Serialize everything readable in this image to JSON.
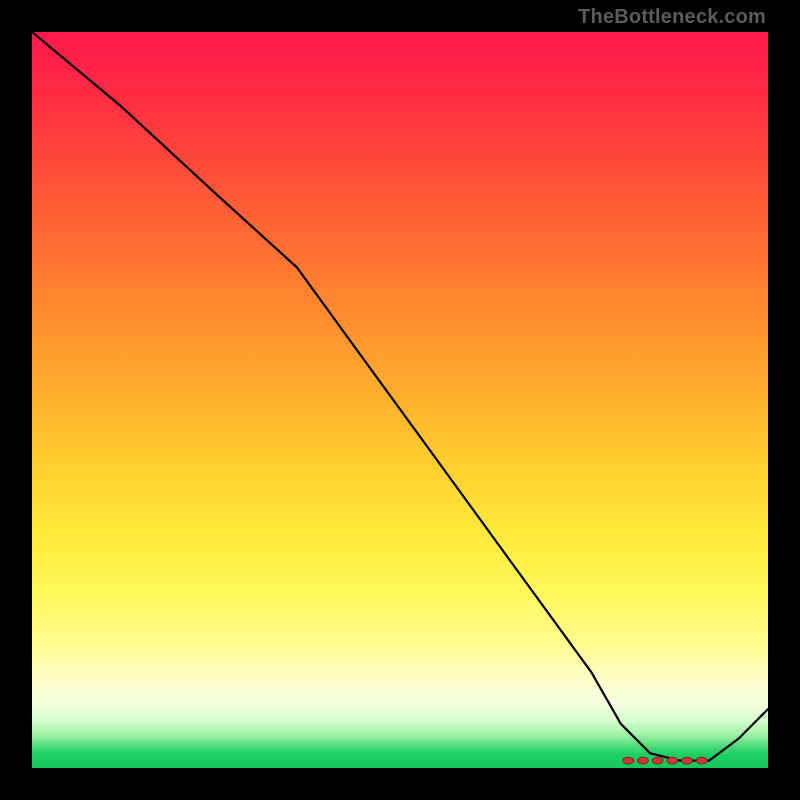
{
  "watermark": "TheBottleneck.com",
  "chart_data": {
    "type": "line",
    "title": "",
    "xlabel": "",
    "ylabel": "",
    "xlim": [
      0,
      100
    ],
    "ylim": [
      0,
      100
    ],
    "grid": false,
    "series": [
      {
        "name": "curve",
        "x": [
          0,
          12,
          25,
          36,
          44,
          52,
          60,
          68,
          76,
          80,
          84,
          88,
          92,
          96,
          100
        ],
        "values": [
          100,
          90,
          78,
          68,
          57,
          46,
          35,
          24,
          13,
          6,
          2,
          1,
          1,
          4,
          8
        ]
      }
    ],
    "markers": {
      "name": "highlight-band",
      "x": [
        81,
        83,
        85,
        87,
        89,
        91
      ],
      "values": [
        1,
        1,
        1,
        1,
        1,
        1
      ]
    },
    "background_gradient": {
      "direction": "vertical",
      "stops": [
        {
          "pos": 0.0,
          "color": "#ff1a4d"
        },
        {
          "pos": 0.5,
          "color": "#ffcc2f"
        },
        {
          "pos": 0.8,
          "color": "#fffc8e"
        },
        {
          "pos": 0.95,
          "color": "#9ff2a6"
        },
        {
          "pos": 1.0,
          "color": "#17c65c"
        }
      ]
    }
  }
}
